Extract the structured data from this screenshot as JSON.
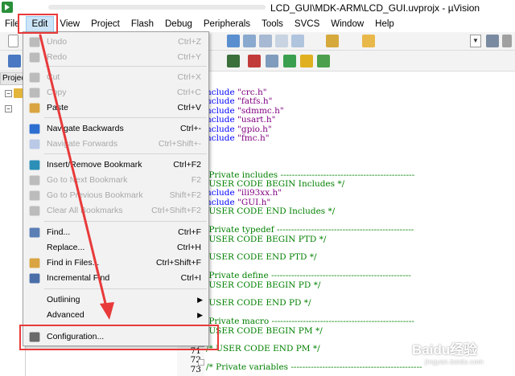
{
  "window": {
    "title": "LCD_GUI\\MDK-ARM\\LCD_GUI.uvprojx - µVision"
  },
  "menubar": [
    "File",
    "Edit",
    "View",
    "Project",
    "Flash",
    "Debug",
    "Peripherals",
    "Tools",
    "SVCS",
    "Window",
    "Help"
  ],
  "edit_menu": {
    "items": [
      {
        "label": "Undo",
        "shortcut": "Ctrl+Z",
        "icon": "undo-icon",
        "enabled": false
      },
      {
        "label": "Redo",
        "shortcut": "Ctrl+Y",
        "icon": "redo-icon",
        "enabled": false
      },
      {
        "label": "Cut",
        "shortcut": "Ctrl+X",
        "icon": "scissors-icon",
        "enabled": false
      },
      {
        "label": "Copy",
        "shortcut": "Ctrl+C",
        "icon": "copy-icon",
        "enabled": false
      },
      {
        "label": "Paste",
        "shortcut": "Ctrl+V",
        "icon": "paste-icon",
        "enabled": true
      },
      {
        "label": "Navigate Backwards",
        "shortcut": "Ctrl+-",
        "icon": "arrow-left-icon",
        "enabled": true
      },
      {
        "label": "Navigate Forwards",
        "shortcut": "Ctrl+Shift+-",
        "icon": "arrow-right-icon",
        "enabled": false
      },
      {
        "label": "Insert/Remove Bookmark",
        "shortcut": "Ctrl+F2",
        "icon": "bookmark-icon",
        "enabled": true
      },
      {
        "label": "Go to Next Bookmark",
        "shortcut": "F2",
        "icon": "next-bookmark-icon",
        "enabled": false
      },
      {
        "label": "Go to Previous Bookmark",
        "shortcut": "Shift+F2",
        "icon": "prev-bookmark-icon",
        "enabled": false
      },
      {
        "label": "Clear All Bookmarks",
        "shortcut": "Ctrl+Shift+F2",
        "icon": "clear-bookmarks-icon",
        "enabled": false
      },
      {
        "label": "Find...",
        "shortcut": "Ctrl+F",
        "icon": "find-icon",
        "enabled": true
      },
      {
        "label": "Replace...",
        "shortcut": "Ctrl+H",
        "icon": "",
        "enabled": true
      },
      {
        "label": "Find in Files...",
        "shortcut": "Ctrl+Shift+F",
        "icon": "find-in-files-icon",
        "enabled": true
      },
      {
        "label": "Incremental Find",
        "shortcut": "Ctrl+I",
        "icon": "incremental-find-icon",
        "enabled": true
      },
      {
        "label": "Outlining",
        "shortcut": "",
        "icon": "",
        "enabled": true,
        "submenu": true
      },
      {
        "label": "Advanced",
        "shortcut": "",
        "icon": "",
        "enabled": true,
        "submenu": true
      },
      {
        "label": "Configuration...",
        "shortcut": "",
        "icon": "wrench-icon",
        "enabled": true
      }
    ]
  },
  "project_tab": "Project",
  "code_lines": [
    {
      "parts": [
        [
          "k",
          "nclude "
        ],
        [
          "s",
          "\"crc.h\""
        ]
      ]
    },
    {
      "parts": [
        [
          "k",
          "nclude "
        ],
        [
          "s",
          "\"fatfs.h\""
        ]
      ]
    },
    {
      "parts": [
        [
          "k",
          "nclude "
        ],
        [
          "s",
          "\"sdmmc.h\""
        ]
      ]
    },
    {
      "parts": [
        [
          "k",
          "nclude "
        ],
        [
          "s",
          "\"usart.h\""
        ]
      ]
    },
    {
      "parts": [
        [
          "k",
          "nclude "
        ],
        [
          "s",
          "\"gpio.h\""
        ]
      ]
    },
    {
      "parts": [
        [
          "k",
          "nclude "
        ],
        [
          "s",
          "\"fmc.h\""
        ]
      ]
    },
    {
      "parts": []
    },
    {
      "parts": []
    },
    {
      "parts": []
    },
    {
      "parts": [
        [
          "c",
          " Private includes -----------------------------------------------"
        ]
      ]
    },
    {
      "parts": [
        [
          "c",
          " USER CODE BEGIN Includes */"
        ]
      ]
    },
    {
      "parts": [
        [
          "k",
          "nclude "
        ],
        [
          "s",
          "\"ili93xx.h\""
        ]
      ]
    },
    {
      "parts": [
        [
          "k",
          "nclude "
        ],
        [
          "s",
          "\"GUI.h\""
        ]
      ]
    },
    {
      "parts": [
        [
          "c",
          " USER CODE END Includes */"
        ]
      ]
    },
    {
      "parts": []
    },
    {
      "parts": [
        [
          "c",
          " Private typedef ------------------------------------------------"
        ]
      ]
    },
    {
      "parts": [
        [
          "c",
          " USER CODE BEGIN PTD */"
        ]
      ]
    },
    {
      "parts": []
    },
    {
      "parts": [
        [
          "c",
          " USER CODE END PTD */"
        ]
      ]
    },
    {
      "parts": []
    },
    {
      "parts": [
        [
          "c",
          " Private define -------------------------------------------------"
        ]
      ]
    },
    {
      "parts": [
        [
          "c",
          " USER CODE BEGIN PD */"
        ]
      ]
    },
    {
      "parts": []
    },
    {
      "parts": [
        [
          "c",
          " USER CODE END PD */"
        ]
      ]
    },
    {
      "parts": []
    },
    {
      "parts": [
        [
          "c",
          " Private macro --------------------------------------------------"
        ]
      ]
    },
    {
      "parts": [
        [
          "c",
          " USER CODE BEGIN PM */"
        ]
      ]
    },
    {
      "parts": []
    },
    {
      "parts": [
        [
          "c",
          "/* USER CODE END PM */"
        ]
      ]
    },
    {
      "parts": []
    },
    {
      "parts": [
        [
          "c",
          "/* Private variables ----------------------------------------------"
        ]
      ]
    }
  ],
  "line_numbers": [
    "71",
    "72",
    "73"
  ],
  "watermark": {
    "brand": "Baidu经验",
    "url": "jingyan.baidu.com"
  },
  "colors": {
    "annotation_red": "#e83a3a",
    "menu_bg": "#f2f2f2",
    "comment_green": "#008000",
    "string_purple": "#800080",
    "keyword_blue": "#0000ff"
  }
}
